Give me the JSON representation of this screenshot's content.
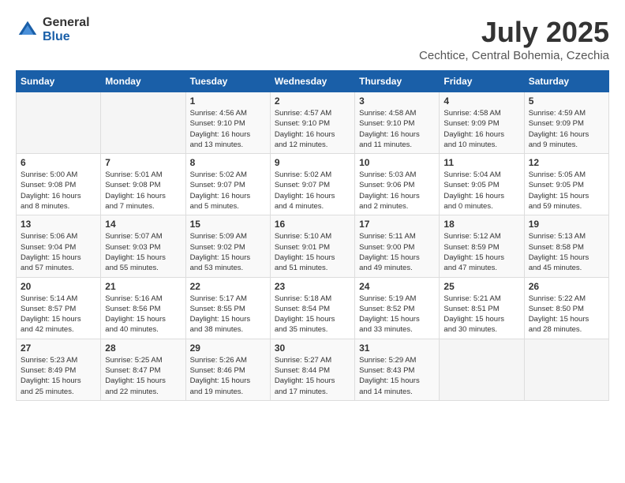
{
  "logo": {
    "general": "General",
    "blue": "Blue"
  },
  "title": {
    "month": "July 2025",
    "location": "Cechtice, Central Bohemia, Czechia"
  },
  "headers": [
    "Sunday",
    "Monday",
    "Tuesday",
    "Wednesday",
    "Thursday",
    "Friday",
    "Saturday"
  ],
  "weeks": [
    [
      {
        "day": "",
        "info": ""
      },
      {
        "day": "",
        "info": ""
      },
      {
        "day": "1",
        "info": "Sunrise: 4:56 AM\nSunset: 9:10 PM\nDaylight: 16 hours\nand 13 minutes."
      },
      {
        "day": "2",
        "info": "Sunrise: 4:57 AM\nSunset: 9:10 PM\nDaylight: 16 hours\nand 12 minutes."
      },
      {
        "day": "3",
        "info": "Sunrise: 4:58 AM\nSunset: 9:10 PM\nDaylight: 16 hours\nand 11 minutes."
      },
      {
        "day": "4",
        "info": "Sunrise: 4:58 AM\nSunset: 9:09 PM\nDaylight: 16 hours\nand 10 minutes."
      },
      {
        "day": "5",
        "info": "Sunrise: 4:59 AM\nSunset: 9:09 PM\nDaylight: 16 hours\nand 9 minutes."
      }
    ],
    [
      {
        "day": "6",
        "info": "Sunrise: 5:00 AM\nSunset: 9:08 PM\nDaylight: 16 hours\nand 8 minutes."
      },
      {
        "day": "7",
        "info": "Sunrise: 5:01 AM\nSunset: 9:08 PM\nDaylight: 16 hours\nand 7 minutes."
      },
      {
        "day": "8",
        "info": "Sunrise: 5:02 AM\nSunset: 9:07 PM\nDaylight: 16 hours\nand 5 minutes."
      },
      {
        "day": "9",
        "info": "Sunrise: 5:02 AM\nSunset: 9:07 PM\nDaylight: 16 hours\nand 4 minutes."
      },
      {
        "day": "10",
        "info": "Sunrise: 5:03 AM\nSunset: 9:06 PM\nDaylight: 16 hours\nand 2 minutes."
      },
      {
        "day": "11",
        "info": "Sunrise: 5:04 AM\nSunset: 9:05 PM\nDaylight: 16 hours\nand 0 minutes."
      },
      {
        "day": "12",
        "info": "Sunrise: 5:05 AM\nSunset: 9:05 PM\nDaylight: 15 hours\nand 59 minutes."
      }
    ],
    [
      {
        "day": "13",
        "info": "Sunrise: 5:06 AM\nSunset: 9:04 PM\nDaylight: 15 hours\nand 57 minutes."
      },
      {
        "day": "14",
        "info": "Sunrise: 5:07 AM\nSunset: 9:03 PM\nDaylight: 15 hours\nand 55 minutes."
      },
      {
        "day": "15",
        "info": "Sunrise: 5:09 AM\nSunset: 9:02 PM\nDaylight: 15 hours\nand 53 minutes."
      },
      {
        "day": "16",
        "info": "Sunrise: 5:10 AM\nSunset: 9:01 PM\nDaylight: 15 hours\nand 51 minutes."
      },
      {
        "day": "17",
        "info": "Sunrise: 5:11 AM\nSunset: 9:00 PM\nDaylight: 15 hours\nand 49 minutes."
      },
      {
        "day": "18",
        "info": "Sunrise: 5:12 AM\nSunset: 8:59 PM\nDaylight: 15 hours\nand 47 minutes."
      },
      {
        "day": "19",
        "info": "Sunrise: 5:13 AM\nSunset: 8:58 PM\nDaylight: 15 hours\nand 45 minutes."
      }
    ],
    [
      {
        "day": "20",
        "info": "Sunrise: 5:14 AM\nSunset: 8:57 PM\nDaylight: 15 hours\nand 42 minutes."
      },
      {
        "day": "21",
        "info": "Sunrise: 5:16 AM\nSunset: 8:56 PM\nDaylight: 15 hours\nand 40 minutes."
      },
      {
        "day": "22",
        "info": "Sunrise: 5:17 AM\nSunset: 8:55 PM\nDaylight: 15 hours\nand 38 minutes."
      },
      {
        "day": "23",
        "info": "Sunrise: 5:18 AM\nSunset: 8:54 PM\nDaylight: 15 hours\nand 35 minutes."
      },
      {
        "day": "24",
        "info": "Sunrise: 5:19 AM\nSunset: 8:52 PM\nDaylight: 15 hours\nand 33 minutes."
      },
      {
        "day": "25",
        "info": "Sunrise: 5:21 AM\nSunset: 8:51 PM\nDaylight: 15 hours\nand 30 minutes."
      },
      {
        "day": "26",
        "info": "Sunrise: 5:22 AM\nSunset: 8:50 PM\nDaylight: 15 hours\nand 28 minutes."
      }
    ],
    [
      {
        "day": "27",
        "info": "Sunrise: 5:23 AM\nSunset: 8:49 PM\nDaylight: 15 hours\nand 25 minutes."
      },
      {
        "day": "28",
        "info": "Sunrise: 5:25 AM\nSunset: 8:47 PM\nDaylight: 15 hours\nand 22 minutes."
      },
      {
        "day": "29",
        "info": "Sunrise: 5:26 AM\nSunset: 8:46 PM\nDaylight: 15 hours\nand 19 minutes."
      },
      {
        "day": "30",
        "info": "Sunrise: 5:27 AM\nSunset: 8:44 PM\nDaylight: 15 hours\nand 17 minutes."
      },
      {
        "day": "31",
        "info": "Sunrise: 5:29 AM\nSunset: 8:43 PM\nDaylight: 15 hours\nand 14 minutes."
      },
      {
        "day": "",
        "info": ""
      },
      {
        "day": "",
        "info": ""
      }
    ]
  ]
}
